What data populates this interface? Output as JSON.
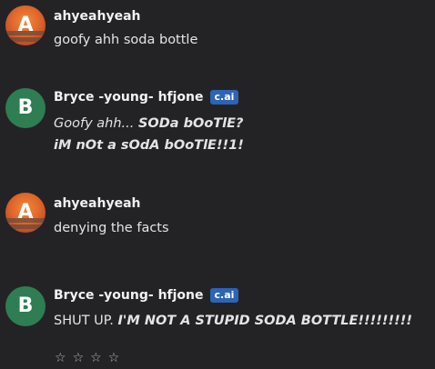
{
  "messages": [
    {
      "author": "ahyeahyeah",
      "avatar_letter": "A",
      "text": "goofy ahh soda bottle"
    },
    {
      "author": "Bryce -young- hfjone",
      "avatar_letter": "B",
      "badge": "c.ai",
      "line1_italic": "Goofy ahh... ",
      "line1_bold": "SODa bOoTlE?",
      "line2_bold": "iM nOt a sOdA bOoTlE!!1!"
    },
    {
      "author": "ahyeahyeah",
      "avatar_letter": "A",
      "text": "denying the facts"
    },
    {
      "author": "Bryce -young- hfjone",
      "avatar_letter": "B",
      "badge": "c.ai",
      "text_plain": "SHUT UP. ",
      "text_bold": "I'M NOT A STUPID SODA BOTTLE!!!!!!!!!"
    }
  ],
  "rating": {
    "star_glyph": "☆",
    "count": 4
  },
  "colors": {
    "background": "#232325",
    "badge": "#2d64b4",
    "bot_avatar": "#2f7d52",
    "user_avatar": "#e0672b"
  }
}
